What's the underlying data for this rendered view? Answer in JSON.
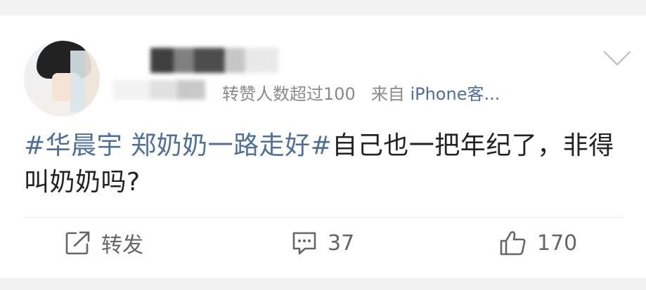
{
  "post": {
    "meta_forward_count": "转赞人数超过100",
    "meta_source_prefix": "来自 ",
    "meta_source_device": "iPhone客...",
    "content": {
      "hashtag": "#华晨宇 郑奶奶一路走好#",
      "text": "自己也一把年纪了，非得叫奶奶吗?"
    }
  },
  "actions": {
    "forward_label": "转发",
    "comment_count": "37",
    "like_count": "170"
  },
  "icons": {
    "more": "chevron-down-icon",
    "forward": "share-icon",
    "comment": "comment-icon",
    "like": "thumbs-up-icon"
  },
  "colors": {
    "link": "#4e6f99",
    "text": "#222222",
    "muted": "#8a8a8a",
    "page_bg": "#f2f2f2"
  }
}
